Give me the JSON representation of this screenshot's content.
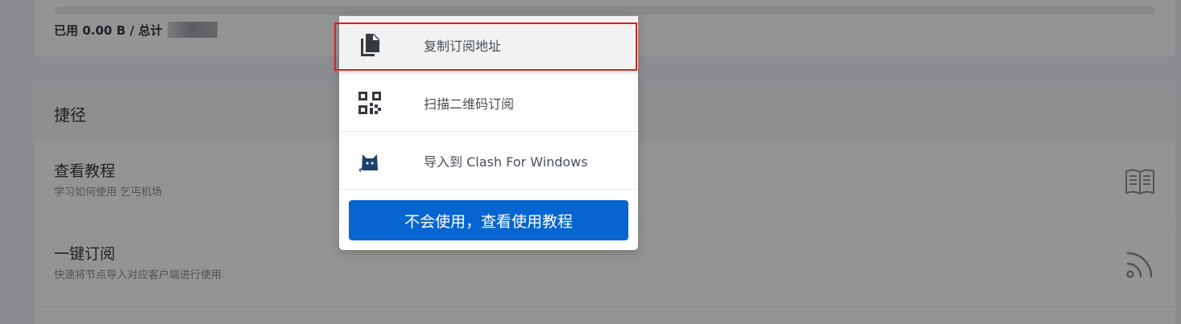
{
  "traffic": {
    "usage_label": "已用 0.00 B / 总计",
    "used_fraction": 0
  },
  "shortcuts": {
    "title": "捷径",
    "items": [
      {
        "title": "查看教程",
        "desc": "学习如何使用 乞丐机场",
        "icon": "book-icon"
      },
      {
        "title": "一键订阅",
        "desc": "快速将节点导入对应客户端进行使用",
        "icon": "rss-icon"
      }
    ]
  },
  "menu": {
    "items": [
      {
        "label": "复制订阅地址",
        "icon": "copy-icon",
        "highlighted": true
      },
      {
        "label": "扫描二维码订阅",
        "icon": "qrcode-icon",
        "highlighted": false
      },
      {
        "label": "导入到 Clash For Windows",
        "icon": "clash-cat-icon",
        "highlighted": false
      }
    ],
    "tutorial_button": "不会使用，查看使用教程"
  },
  "colors": {
    "primary": "#0665d0",
    "highlight_border": "#e01e1e",
    "overlay": "rgba(0,0,0,0.42)"
  }
}
